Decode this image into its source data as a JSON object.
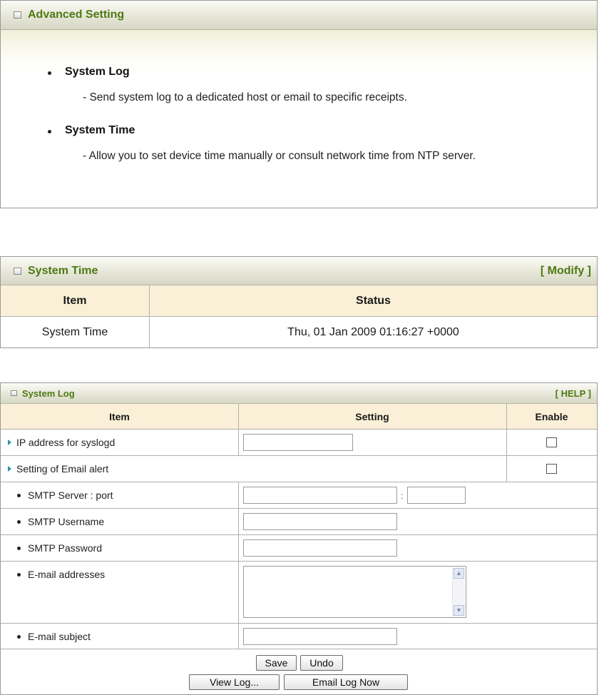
{
  "advanced": {
    "title": "Advanced Setting",
    "items": [
      {
        "heading": "System Log",
        "desc": "- Send system log to a dedicated host or email to specific receipts."
      },
      {
        "heading": "System Time",
        "desc": "- Allow you to set device time manually or consult network time from NTP server."
      }
    ]
  },
  "system_time": {
    "title": "System Time",
    "link": "[ Modify ]",
    "headers": {
      "item": "Item",
      "status": "Status"
    },
    "row": {
      "item": "System Time",
      "status": "Thu, 01 Jan 2009 01:16:27 +0000"
    }
  },
  "system_log": {
    "title": "System Log",
    "link": "[ HELP ]",
    "headers": {
      "item": "Item",
      "setting": "Setting",
      "enable": "Enable"
    },
    "rows": {
      "ip": "IP address for syslogd",
      "email_alert": "Setting of Email alert",
      "smtp_server": "SMTP Server : port",
      "port_sep": ":",
      "smtp_user": "SMTP Username",
      "smtp_pass": "SMTP Password",
      "emails": "E-mail addresses",
      "subject": "E-mail subject"
    },
    "values": {
      "ip": "",
      "smtp_server": "",
      "smtp_port": "",
      "smtp_user": "",
      "smtp_pass": "",
      "emails": "",
      "subject": ""
    },
    "buttons": {
      "save": "Save",
      "undo": "Undo",
      "view_log": "View Log...",
      "email_log": "Email Log Now"
    }
  }
}
